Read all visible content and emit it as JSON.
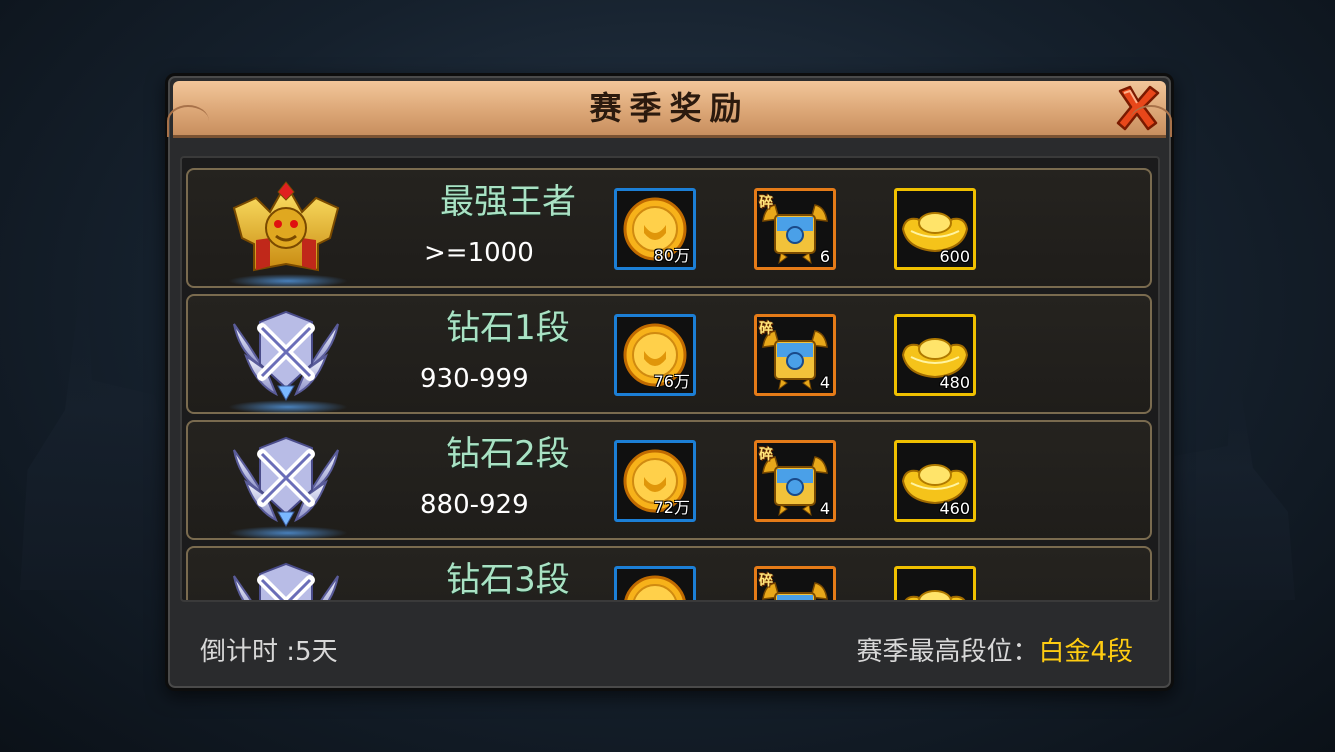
{
  "dialog": {
    "title": "赛季奖励",
    "close_icon": "close-x-icon"
  },
  "tiers": [
    {
      "name": "最强王者",
      "range": ">=1000",
      "emblem": "king-emblem-icon",
      "rewards": [
        {
          "type": "coin",
          "qty": "80万"
        },
        {
          "type": "chest-shard",
          "tag": "碎",
          "qty": "6"
        },
        {
          "type": "gold-ingot",
          "qty": "600"
        }
      ]
    },
    {
      "name": "钻石1段",
      "range": "930-999",
      "emblem": "diamond-emblem-icon",
      "rewards": [
        {
          "type": "coin",
          "qty": "76万"
        },
        {
          "type": "chest-shard",
          "tag": "碎",
          "qty": "4"
        },
        {
          "type": "gold-ingot",
          "qty": "480"
        }
      ]
    },
    {
      "name": "钻石2段",
      "range": "880-929",
      "emblem": "diamond-emblem-icon",
      "rewards": [
        {
          "type": "coin",
          "qty": "72万"
        },
        {
          "type": "chest-shard",
          "tag": "碎",
          "qty": "4"
        },
        {
          "type": "gold-ingot",
          "qty": "460"
        }
      ]
    },
    {
      "name": "钻石3段",
      "range": "",
      "emblem": "diamond-emblem-icon",
      "rewards": [
        {
          "type": "coin",
          "qty": ""
        },
        {
          "type": "chest-shard",
          "tag": "碎",
          "qty": ""
        },
        {
          "type": "gold-ingot",
          "qty": ""
        }
      ]
    }
  ],
  "footer": {
    "countdown": "倒计时 :5天",
    "best_rank_label": "赛季最高段位：",
    "best_rank_value": "白金4段"
  },
  "colors": {
    "title_bar": "#dca777",
    "rank_name": "#a9e2c4",
    "best_rank": "#ffcc11",
    "coin_border": "#1c7fd6",
    "shard_border": "#e57b18",
    "ingot_border": "#f0c000"
  }
}
